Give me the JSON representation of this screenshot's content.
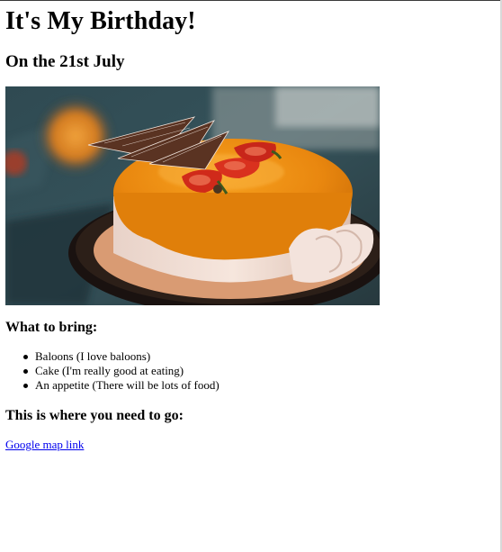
{
  "page": {
    "title": "It's My Birthday!",
    "subtitle": "On the 21st July"
  },
  "image": {
    "subject": "orange glazed birthday cake with strawberries and chocolate decorations"
  },
  "bring": {
    "heading": "What to bring:",
    "items": [
      "Baloons (I love baloons)",
      "Cake (I'm really good at eating)",
      "An appetite (There will be lots of food)"
    ]
  },
  "location": {
    "heading": "This is where you need to go:",
    "link_text": "Google map link"
  },
  "colors": {
    "link": "#0000ee",
    "text": "#000000",
    "background": "#ffffff"
  }
}
